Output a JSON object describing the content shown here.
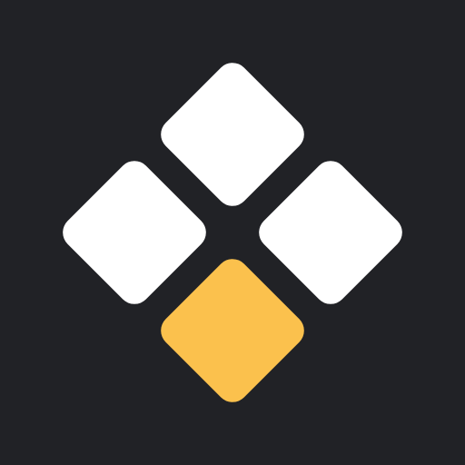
{
  "icon": {
    "name": "four-diamond-grid-logo",
    "colors": {
      "background": "#212226",
      "primary_tile": "#FFFFFF",
      "accent_tile": "#FBC14D"
    },
    "tiles": [
      {
        "name": "tile-top",
        "role": "primary"
      },
      {
        "name": "tile-left",
        "role": "primary"
      },
      {
        "name": "tile-right",
        "role": "primary"
      },
      {
        "name": "tile-bottom",
        "role": "accent"
      }
    ]
  }
}
